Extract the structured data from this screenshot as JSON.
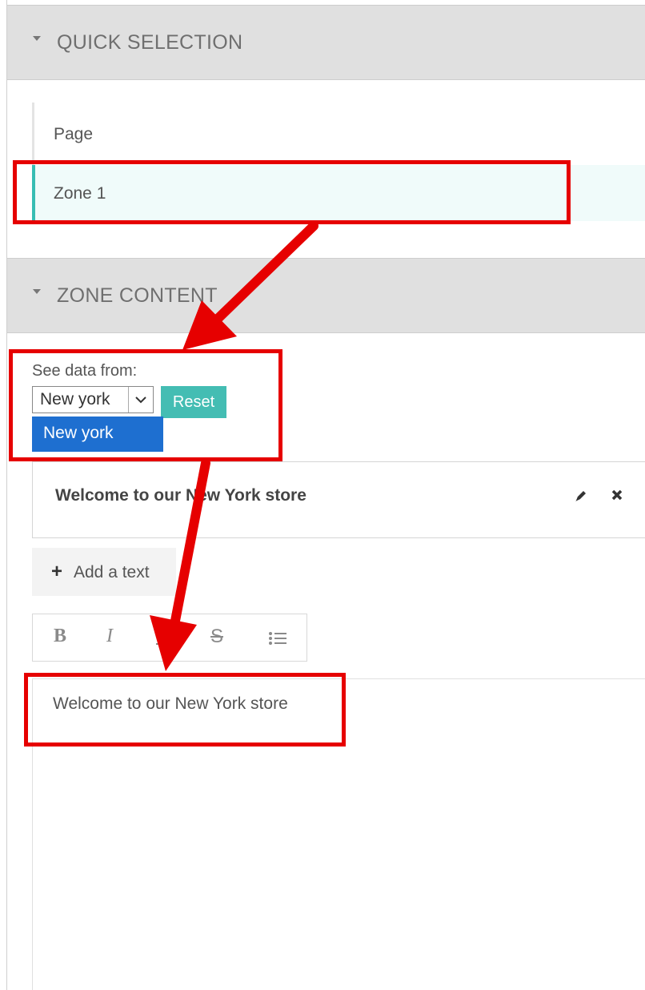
{
  "quick_selection": {
    "title": "QUICK SELECTION",
    "items": [
      {
        "label": "Page",
        "active": false
      },
      {
        "label": "Zone 1",
        "active": true
      }
    ]
  },
  "zone_content": {
    "title": "ZONE CONTENT",
    "see_data_label": "See data from:",
    "select_value": "New york",
    "dropdown_options": [
      "New york"
    ],
    "reset_label": "Reset",
    "text_blocks": [
      {
        "title": "Welcome to our New York store"
      }
    ],
    "add_text_label": "Add a text",
    "toolbar": {
      "bold": "B",
      "italic": "I",
      "underline": "U",
      "strike": "S"
    },
    "editor_content": "Welcome to our New York store"
  },
  "colors": {
    "accent": "#44bdb3",
    "selection_blue": "#1e6fd0",
    "annotation_red": "#e60000",
    "header_bg": "#e0e0e0"
  }
}
